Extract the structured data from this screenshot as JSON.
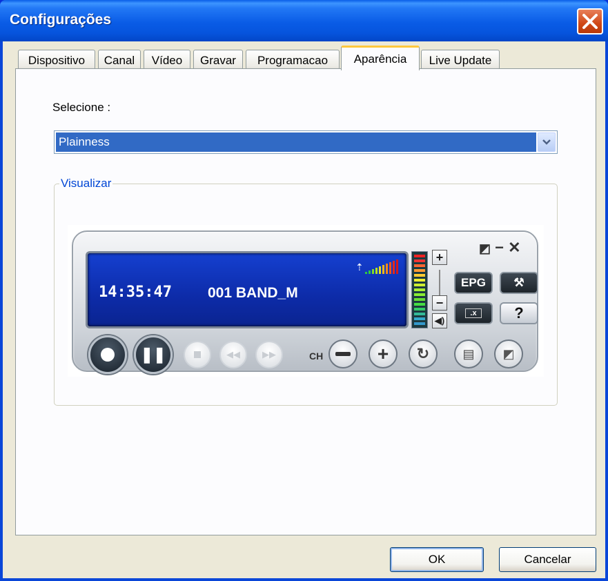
{
  "window": {
    "title": "Configurações"
  },
  "tabs": [
    {
      "label": "Dispositivo"
    },
    {
      "label": "Canal"
    },
    {
      "label": "Vídeo"
    },
    {
      "label": "Gravar"
    },
    {
      "label": "Programacao"
    },
    {
      "label": "Aparência",
      "active": true
    },
    {
      "label": "Live Update"
    }
  ],
  "appearance": {
    "select_label": "Selecione :",
    "selected_skin": "Plainness",
    "preview_title": "Visualizar"
  },
  "preview": {
    "time": "14:35:47",
    "channel": "001 BAND_M",
    "epg_label": "EPG",
    "help_label": "?",
    "ch_label": "CH"
  },
  "footer": {
    "ok_label": "OK",
    "cancel_label": "Cancelar"
  },
  "colors": {
    "title_bar": "#0a5ce6",
    "selection": "#316ac5",
    "group_title": "#0046d5",
    "active_tab_accent": "#ffc83c"
  }
}
